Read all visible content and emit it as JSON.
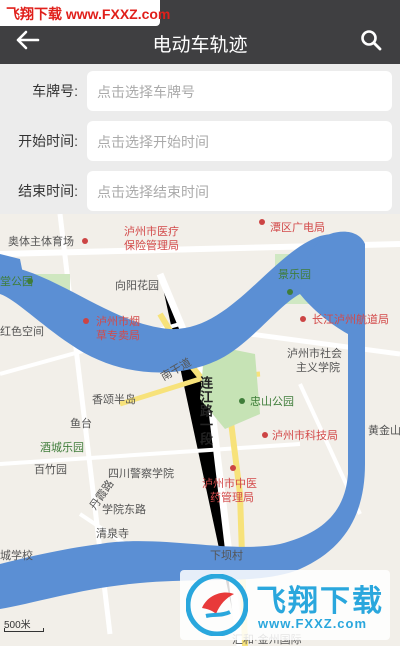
{
  "header": {
    "title": "电动车轨迹",
    "back_icon": "arrow-left-icon",
    "search_icon": "search-icon"
  },
  "watermark_top": "飞翔下载 www.FXXZ.com",
  "form": {
    "plate": {
      "label": "车牌号:",
      "placeholder": "点击选择车牌号"
    },
    "start": {
      "label": "开始时间:",
      "placeholder": "点击选择开始时间"
    },
    "end": {
      "label": "结束时间:",
      "placeholder": "点击选择结束时间"
    }
  },
  "map": {
    "pois": {
      "aoti": "奥体主体育场",
      "yiliao": "泸州市医疗",
      "yiliao2": "保险管理局",
      "tanquan": "潭区广电局",
      "park_left": "堂公园",
      "xiangyang": "向阳花园",
      "jingyuan": "景乐园",
      "yan": "泸州市烟",
      "yan2": "草专卖局",
      "secolor": "红色空间",
      "changjiang": "长江泸州航道局",
      "shehui": "泸州市社会",
      "shehui2": "主义学院",
      "xiangshun": "香颂半岛",
      "zhongshan": "忠山公园",
      "keji": "泸州市科技局",
      "yutai": "鱼台",
      "jiucheng": "酒城乐园",
      "baizhu": "百竹园",
      "police": "四川警察学院",
      "zhongyi": "泸州市中医",
      "zhongyi2": "药管理局",
      "xuexiao": "学院东路",
      "danbao": "丹霞路",
      "qingquan": "清泉寺",
      "xiacuncun": "下坝村",
      "chengxiao": "城学校",
      "huangjin": "黄金山",
      "huahe": "汇和·金州国际",
      "nianyu": "南干道"
    },
    "road_label": "连江路一段",
    "scale_label": "500米"
  },
  "watermark_bottom": {
    "name": "飞翔下载",
    "url": "www.FXXZ.com"
  },
  "colors": {
    "header_bg": "#3f3f41",
    "river": "#5b8fd4",
    "poi_red": "#d34a4a",
    "watermark_blue": "#2aa7dd"
  }
}
